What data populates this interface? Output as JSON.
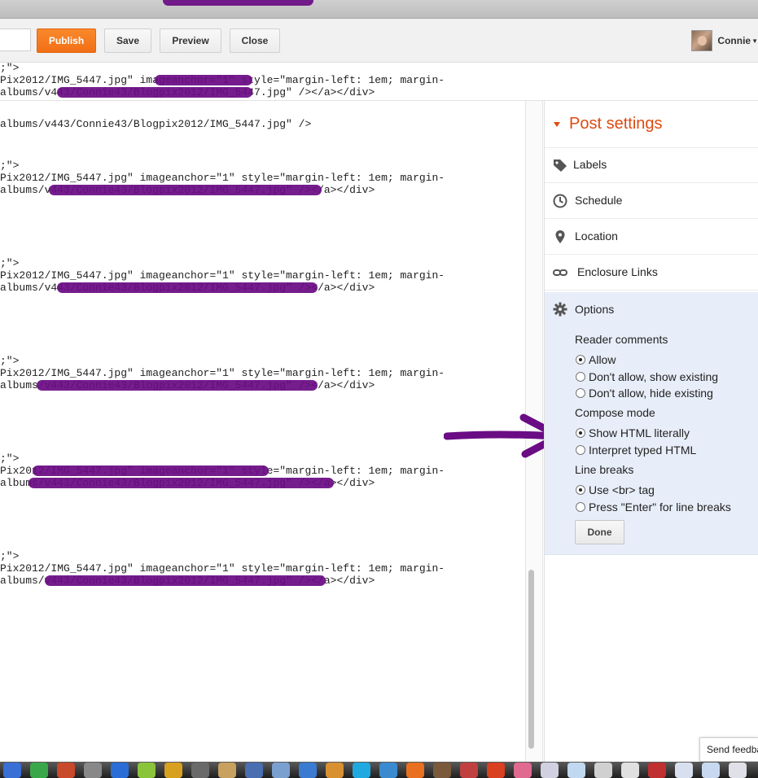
{
  "toolbar": {
    "publish_label": "Publish",
    "save_label": "Save",
    "preview_label": "Preview",
    "close_label": "Close",
    "user_name": "Connie"
  },
  "editor": {
    "blocks": [
      {
        "line1": ";\">",
        "line2": "Pix2012/IMG_5447.jpg\" imageanchor=\"1\" style=\"margin-left: 1em; margin-",
        "line3": "albums/v443/Connie43/Blogpix2012/IMG_5447.jpg\" /></a></div>"
      },
      {
        "line1": ";\">",
        "line2": "Pix2012/IMG_5447.jpg\" imageanchor=\"1\" style=\"margin-left: 1em; margin-",
        "line3": "albums/v443/Connie43/Blogpix2012/IMG_5447.jpg\" /></a></div>"
      },
      {
        "line1": ";\">",
        "line2": "Pix2012/IMG_5447.jpg\" imageanchor=\"1\" style=\"margin-left: 1em; margin-",
        "line3": "albums/v443/Connie43/Blogpix2012/IMG_5447.jpg\" /></a></div>"
      },
      {
        "line1": ";\">",
        "line2": "Pix2012/IMG_5447.jpg\" imageanchor=\"1\" style=\"margin-left: 1em; margin-",
        "line3": "albums/v443/Connie43/Blogpix2012/IMG_5447.jpg\" /></a></div>"
      },
      {
        "line1": ";\">",
        "line2": "Pix2012/IMG_5447.jpg\" imageanchor=\"1\" style=\"margin-left: 1em; margin-",
        "line3": "albums/v443/Connie43/Blogpix2012/IMG_5447.jpg\" /></a></div>"
      },
      {
        "line1": ";\">",
        "line2": "Pix2012/IMG_5447.jpg\" imageanchor=\"1\" style=\"margin-left: 1em; margin-",
        "line3": "albums/v443/Connie43/Blogpix2012/IMG_5447.jpg\" /></a></div>"
      }
    ]
  },
  "sidebar": {
    "title": "Post settings",
    "items": [
      {
        "label": "Labels",
        "icon": "tag-icon"
      },
      {
        "label": "Schedule",
        "icon": "clock-icon"
      },
      {
        "label": "Location",
        "icon": "map-pin-icon"
      },
      {
        "label": "Enclosure Links",
        "icon": "link-icon"
      },
      {
        "label": "Options",
        "icon": "gear-icon"
      }
    ],
    "options": {
      "reader_comments": {
        "heading": "Reader comments",
        "choices": [
          "Allow",
          "Don't allow, show existing",
          "Don't allow, hide existing"
        ],
        "selected": "Allow"
      },
      "compose_mode": {
        "heading": "Compose mode",
        "choices": [
          "Show HTML literally",
          "Interpret typed HTML"
        ],
        "selected": "Show HTML literally"
      },
      "line_breaks": {
        "heading": "Line breaks",
        "choices": [
          "Use <br> tag",
          "Press \"Enter\" for line breaks"
        ],
        "selected": "Use <br> tag"
      },
      "done_label": "Done"
    }
  },
  "feedback_label": "Send feedback",
  "colors": {
    "accent_orange": "#f26f16",
    "title_orange": "#dd4b11",
    "redaction_purple": "#6a0c84",
    "options_bg": "#e8eef9"
  }
}
